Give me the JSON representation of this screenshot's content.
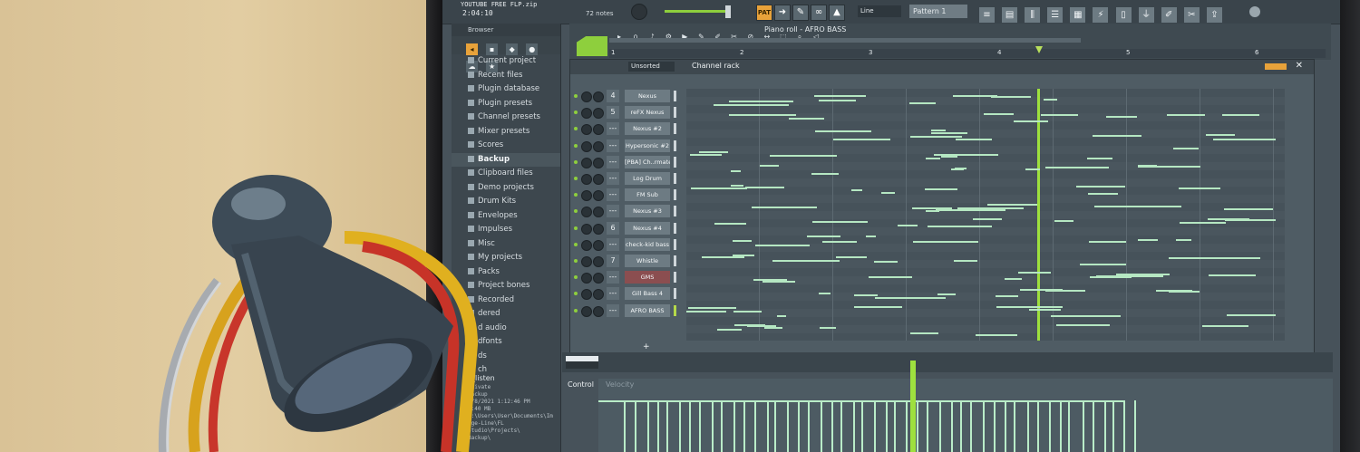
{
  "topbar": {
    "project_title": "YOUTUBE FREE FLP.zip",
    "time": "2:04:10",
    "notes": "72 notes",
    "snap": "Line",
    "pattern": "Pattern 1",
    "mode_button": "PAT"
  },
  "browser": {
    "title": "Browser",
    "items": [
      {
        "label": "Current project",
        "selected": false
      },
      {
        "label": "Recent files",
        "selected": false
      },
      {
        "label": "Plugin database",
        "selected": false
      },
      {
        "label": "Plugin presets",
        "selected": false
      },
      {
        "label": "Channel presets",
        "selected": false
      },
      {
        "label": "Mixer presets",
        "selected": false
      },
      {
        "label": "Scores",
        "selected": false
      },
      {
        "label": "Backup",
        "selected": true
      },
      {
        "label": "Clipboard files",
        "selected": false
      },
      {
        "label": "Demo projects",
        "selected": false
      },
      {
        "label": "Drum Kits",
        "selected": false
      },
      {
        "label": "Envelopes",
        "selected": false
      },
      {
        "label": "Impulses",
        "selected": false
      },
      {
        "label": "Misc",
        "selected": false
      },
      {
        "label": "My projects",
        "selected": false
      },
      {
        "label": "Packs",
        "selected": false
      },
      {
        "label": "Project bones",
        "selected": false
      },
      {
        "label": "Recorded",
        "selected": false
      },
      {
        "label": "dered",
        "selected": false
      },
      {
        "label": "d audio",
        "selected": false
      },
      {
        "label": "dfonts",
        "selected": false
      },
      {
        "label": "ds",
        "selected": false
      },
      {
        "label": "ch",
        "selected": false
      }
    ],
    "panel_label": "_listen",
    "info_lines": [
      "Private",
      "Backup",
      "1/8/2021 1:12:46 PM",
      "1:40 MB",
      "C:\\Users\\User\\Documents\\Im",
      "age-Line\\FL Studio\\Projects\\",
      "Backup\\"
    ]
  },
  "piano_roll": {
    "title": "Piano roll - AFRO BASS",
    "bars": [
      "1",
      "2",
      "3",
      "4",
      "5",
      "6"
    ]
  },
  "channel_rack": {
    "title": "Channel rack",
    "sort": "Unsorted",
    "channels": [
      {
        "num": "4",
        "name": "Nexus",
        "red": false,
        "lit": false
      },
      {
        "num": "5",
        "name": "reFX Nexus",
        "red": false,
        "lit": false
      },
      {
        "num": "---",
        "name": "Nexus #2",
        "red": false,
        "lit": false
      },
      {
        "num": "---",
        "name": "Hypersonic #2",
        "red": false,
        "lit": false
      },
      {
        "num": "---",
        "name": "[PBA] Ch..rmate]",
        "red": false,
        "lit": false
      },
      {
        "num": "---",
        "name": "Log Drum",
        "red": false,
        "lit": false
      },
      {
        "num": "---",
        "name": "FM Sub",
        "red": false,
        "lit": false
      },
      {
        "num": "---",
        "name": "Nexus #3",
        "red": false,
        "lit": false
      },
      {
        "num": "6",
        "name": "Nexus #4",
        "red": false,
        "lit": false
      },
      {
        "num": "---",
        "name": "check-kid bass",
        "red": false,
        "lit": false
      },
      {
        "num": "7",
        "name": "Whistle",
        "red": false,
        "lit": false
      },
      {
        "num": "---",
        "name": "GMS",
        "red": true,
        "lit": false
      },
      {
        "num": "---",
        "name": "Gill Bass 4",
        "red": false,
        "lit": false
      },
      {
        "num": "---",
        "name": "AFRO BASS",
        "red": false,
        "lit": true
      }
    ],
    "add_label": "+"
  },
  "control": {
    "label": "Control",
    "lane": "Velocity"
  },
  "colors": {
    "accent_green": "#8ecf3d",
    "note": "#b5e7c2",
    "button_orange": "#e8a23a"
  }
}
